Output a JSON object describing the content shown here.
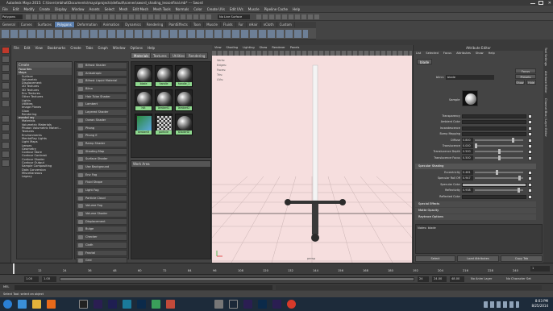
{
  "window": {
    "title": "Autodesk Maya 2015: C:\\Users\\mbhat\\Documents\\maya\\projects\\default\\scenes\\sword_shading_lessonfinal.mb* --- Sword"
  },
  "menubar": [
    "File",
    "Edit",
    "Modify",
    "Create",
    "Display",
    "Window",
    "Assets",
    "Select",
    "Mesh",
    "Edit Mesh",
    "Mesh Tools",
    "Normals",
    "Color",
    "Create UVs",
    "Edit UVs",
    "Muscle",
    "Pipeline Cache",
    "Help"
  ],
  "statusline": {
    "mode": "Polygons",
    "live_surface": "No Live Surface"
  },
  "shelf_tabs": [
    "General",
    "Curves",
    "Surfaces",
    "Polygons",
    "Deformation",
    "Animation",
    "Dynamics",
    "Rendering",
    "PaintEffects",
    "Toon",
    "Muscle",
    "Fluids",
    "Fur",
    "nHair",
    "nCloth",
    "Custom",
    "GoZBrush"
  ],
  "shelf_active": "Polygons",
  "hypershade": {
    "menu": [
      "File",
      "Edit",
      "View",
      "Bookmarks",
      "Create",
      "Tabs",
      "Graph",
      "Window",
      "Options",
      "Help"
    ],
    "tabs": [
      "Materials",
      "Textures",
      "Utilities",
      "Rendering"
    ],
    "create_header": "Create",
    "work_header": "Work Area",
    "create_list": [
      {
        "label": "Favorites",
        "cat": true
      },
      {
        "label": "Maya",
        "cat": true
      },
      {
        "label": "Surface",
        "cat": false
      },
      {
        "label": "Volumetric",
        "cat": false
      },
      {
        "label": "Displacement",
        "cat": false
      },
      {
        "label": "2D Textures",
        "cat": false
      },
      {
        "label": "3D Textures",
        "cat": false
      },
      {
        "label": "Env Textures",
        "cat": false
      },
      {
        "label": "Other Textures",
        "cat": false
      },
      {
        "label": "Lights",
        "cat": false
      },
      {
        "label": "Utilities",
        "cat": false
      },
      {
        "label": "Image Planes",
        "cat": false
      },
      {
        "label": "Glow",
        "cat": false
      },
      {
        "label": "Rendering",
        "cat": false
      },
      {
        "label": "mental ray",
        "cat": true
      },
      {
        "label": "Materials",
        "cat": false
      },
      {
        "label": "Volumetric Materials",
        "cat": false
      },
      {
        "label": "Photon Volumetric Materi...",
        "cat": false
      },
      {
        "label": "Textures",
        "cat": false
      },
      {
        "label": "Environments",
        "cat": false
      },
      {
        "label": "MentalRay Lights",
        "cat": false
      },
      {
        "label": "Light Maps",
        "cat": false
      },
      {
        "label": "Lenses",
        "cat": false
      },
      {
        "label": "Geometry",
        "cat": false
      },
      {
        "label": "Contour Store",
        "cat": false
      },
      {
        "label": "Contour Contrast",
        "cat": false
      },
      {
        "label": "Contour Shader",
        "cat": false
      },
      {
        "label": "Contour Output",
        "cat": false
      },
      {
        "label": "Sample Compositing",
        "cat": false
      },
      {
        "label": "Data Conversion",
        "cat": false
      },
      {
        "label": "Miscellaneous",
        "cat": false
      },
      {
        "label": "Legacy",
        "cat": false
      }
    ],
    "nodes": [
      "Bifrost Shader",
      "Anisotropic",
      "Bifrost Liquid Material",
      "Blinn",
      "Hair Tube Shader",
      "Lambert",
      "Layered Shader",
      "Ocean Shader",
      "Phong",
      "Phong E",
      "Ramp Shader",
      "Shading Map",
      "Surface Shader",
      "Use Background",
      "Env Fog",
      "Fluid Shape",
      "Light Fog",
      "Particle Cloud",
      "Volume Fog",
      "Volume Shader",
      "Displacement",
      "Bulge",
      "Checker",
      "Cloth",
      "Fractal",
      "Grid"
    ],
    "swatches": [
      "blade",
      "handle",
      "handle_1",
      "hilt",
      "lambert1",
      "lambert2",
      "lambert3",
      "particle",
      "shaderGl"
    ]
  },
  "viewport": {
    "menu": [
      "View",
      "Shading",
      "Lighting",
      "Show",
      "Renderer",
      "Panels"
    ],
    "hud": [
      "Verts:",
      "Edges:",
      "Faces:",
      "Tris:",
      "UVs:"
    ],
    "camera": "persp"
  },
  "attribute_editor": {
    "title": "Attribute Editor",
    "menu": [
      "List",
      "Selected",
      "Focus",
      "Attributes",
      "Show",
      "Help"
    ],
    "tab": "blade",
    "type_label": "blinn:",
    "name_value": "blade",
    "focus_label": "Focus",
    "presets_label": "Presets",
    "show_label": "Show",
    "hide_label": "Hide",
    "sample_label": "Sample",
    "rows": [
      {
        "label": "Transparency",
        "value": ""
      },
      {
        "label": "Ambient Color",
        "value": ""
      },
      {
        "label": "Incandescence",
        "value": ""
      },
      {
        "label": "Bump Mapping",
        "value": ""
      },
      {
        "label": "Diffuse",
        "value": "0.800"
      },
      {
        "label": "Translucence",
        "value": "0.000"
      },
      {
        "label": "Translucence Depth",
        "value": "0.500"
      },
      {
        "label": "Translucence Focus",
        "value": "0.500"
      }
    ],
    "spec_section": "Specular Shading",
    "spec_rows": [
      {
        "label": "Eccentricity",
        "value": "0.461"
      },
      {
        "label": "Specular Roll Off",
        "value": "0.947"
      },
      {
        "label": "Specular Color",
        "value": ""
      },
      {
        "label": "Reflectivity",
        "value": "0.938"
      },
      {
        "label": "Reflected Color",
        "value": ""
      }
    ],
    "sections": [
      "Special Effects",
      "Matte Opacity",
      "Raytrace Options"
    ],
    "notes": "Notes: blade",
    "buttons": [
      "Select",
      "Load Attributes",
      "Copy Tab"
    ]
  },
  "right_strip": [
    "Tool Settings",
    "Attribute Editor",
    "Channel Box / Layer Editor"
  ],
  "timeline": {
    "ticks": [
      "1",
      "12",
      "24",
      "36",
      "48",
      "60",
      "72",
      "84",
      "96",
      "108",
      "120",
      "132",
      "144",
      "156",
      "168",
      "180",
      "192",
      "204",
      "216",
      "228",
      "240"
    ],
    "current": "1"
  },
  "range": {
    "start": "1.00",
    "inner_start": "1.00",
    "inner_end": "24",
    "end": "24.00",
    "end2": "48.00",
    "anim_layer": "No Anim Layer",
    "char_set": "No Character Set"
  },
  "cmdline": {
    "label": "MEL"
  },
  "helpline": "Select Tool: select an object",
  "clock": {
    "time": "8:03 PM",
    "date": "8/25/2014"
  }
}
